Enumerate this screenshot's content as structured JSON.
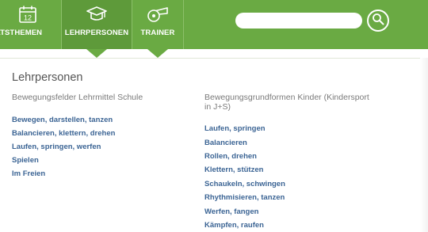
{
  "nav": {
    "items": [
      {
        "label": "NATSTHEMEN",
        "icon": "calendar-icon",
        "icon_text": "12"
      },
      {
        "label": "LEHRPERSONEN",
        "icon": "graduation-cap-icon"
      },
      {
        "label": "TRAINER",
        "icon": "whistle-icon"
      }
    ],
    "active": "LEHRPERSONEN"
  },
  "search": {
    "placeholder": "",
    "value": "",
    "button_icon": "search-icon"
  },
  "page": {
    "title": "Lehrpersonen",
    "left_column": {
      "heading": "Bewegungsfelder Lehrmittel Schule",
      "links": [
        "Bewegen, darstellen, tanzen",
        "Balancieren, klettern, drehen",
        "Laufen, springen, werfen",
        "Spielen",
        "Im Freien"
      ]
    },
    "right_column": {
      "heading_line1": "Bewegungsgrundformen Kinder (Kindersport",
      "heading_line2": "in J+S)",
      "links": [
        "Laufen, springen",
        "Balancieren",
        "Rollen, drehen",
        "Klettern, stützen",
        "Schaukeln, schwingen",
        "Rhythmisieren, tanzen",
        "Werfen, fangen",
        "Kämpfen, raufen"
      ]
    }
  },
  "colors": {
    "nav_green": "#6aaa43",
    "link_blue": "#3b6494",
    "heading_gray": "#7a7a7a"
  }
}
